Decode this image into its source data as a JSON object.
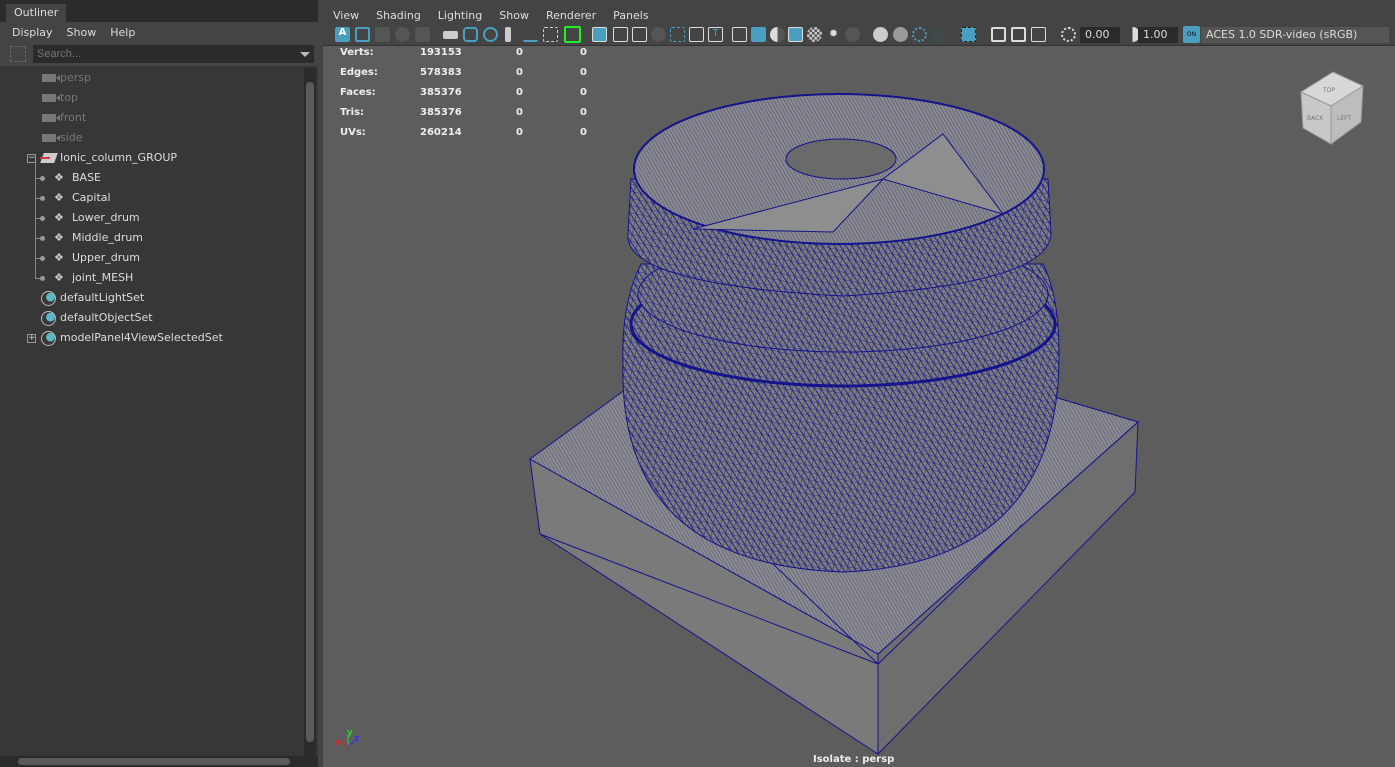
{
  "outliner": {
    "tab": "Outliner",
    "menu": [
      "Display",
      "Show",
      "Help"
    ],
    "search_placeholder": "Search...",
    "items": [
      {
        "label": "persp",
        "icon": "camera-icon",
        "hidden": true
      },
      {
        "label": "top",
        "icon": "camera-icon",
        "hidden": true
      },
      {
        "label": "front",
        "icon": "camera-icon",
        "hidden": true
      },
      {
        "label": "side",
        "icon": "camera-icon",
        "hidden": true
      },
      {
        "label": "Ionic_column_GROUP",
        "icon": "group-icon",
        "expanded": true
      },
      {
        "label": "BASE",
        "icon": "transform-icon"
      },
      {
        "label": "Capital",
        "icon": "transform-icon"
      },
      {
        "label": "Lower_drum",
        "icon": "transform-icon"
      },
      {
        "label": "Middle_drum",
        "icon": "transform-icon"
      },
      {
        "label": "Upper_drum",
        "icon": "transform-icon"
      },
      {
        "label": "joint_MESH",
        "icon": "transform-icon"
      },
      {
        "label": "defaultLightSet",
        "icon": "set-icon"
      },
      {
        "label": "defaultObjectSet",
        "icon": "set-icon"
      },
      {
        "label": "modelPanel4ViewSelectedSet",
        "icon": "set-icon",
        "collapsed": true
      }
    ]
  },
  "viewport": {
    "menu": [
      "View",
      "Shading",
      "Lighting",
      "Show",
      "Renderer",
      "Panels"
    ],
    "exposure": "0.00",
    "gamma": "1.00",
    "color_mgmt_toggle": "ON",
    "color_space": "ACES 1.0 SDR-video (sRGB)",
    "hud": [
      {
        "label": "Verts:",
        "v": [
          "193153",
          "0",
          "0"
        ]
      },
      {
        "label": "Edges:",
        "v": [
          "578383",
          "0",
          "0"
        ]
      },
      {
        "label": "Faces:",
        "v": [
          "385376",
          "0",
          "0"
        ]
      },
      {
        "label": "Tris:",
        "v": [
          "385376",
          "0",
          "0"
        ]
      },
      {
        "label": "UVs:",
        "v": [
          "260214",
          "0",
          "0"
        ]
      }
    ],
    "viewcube": {
      "front": "BACK",
      "side": "LEFT",
      "top": "TOP"
    },
    "axis": {
      "x": "x",
      "y": "y",
      "z": "z"
    },
    "camera_label": "Isolate : persp",
    "colors": {
      "wire": "#14148c",
      "accent": "#4a9ec0",
      "bg": "#5d5d5d"
    }
  }
}
